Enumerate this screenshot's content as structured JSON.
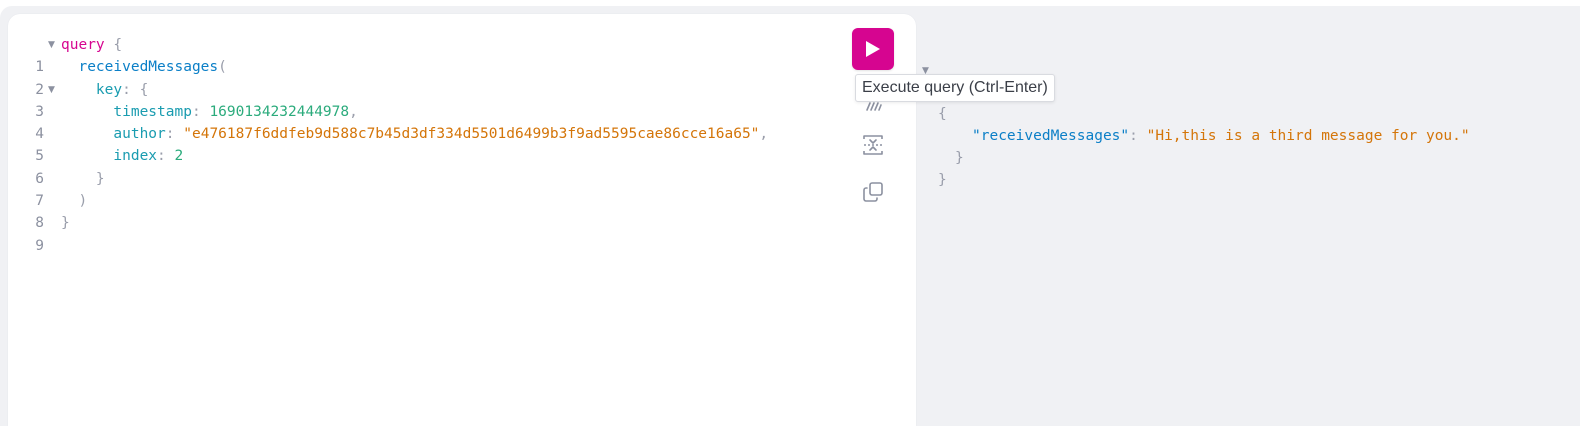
{
  "toolbar": {
    "run_tooltip": "Execute query (Ctrl-Enter)",
    "run_icon": "play-icon",
    "prettify_icon": "prettify-icon",
    "merge_icon": "merge-fragments-icon",
    "copy_icon": "copy-icon"
  },
  "editor": {
    "line_numbers": [
      "1",
      "2",
      "3",
      "4",
      "5",
      "6",
      "7",
      "8",
      "9"
    ],
    "query_keyword": "query",
    "open_brace": "{",
    "field_name": "receivedMessages",
    "open_paren": "(",
    "arg_key": "key",
    "arg_key_colon": ":",
    "arg_key_brace": "{",
    "timestamp_label": "timestamp",
    "timestamp_value": "1690134232444978",
    "author_label": "author",
    "author_value": "\"e476187f6ddfeb9d588c7b45d3df334d5501d6499b3f9ad5595cae86cce16a65\"",
    "index_label": "index",
    "index_value": "2",
    "colon": ":",
    "comma": ",",
    "close_inner_brace": "}",
    "close_paren": ")",
    "close_brace": "}"
  },
  "result": {
    "open_brace": "{",
    "key": "\"receivedMessages\"",
    "colon": ":",
    "value": "\"Hi,this is a third message for you.\"",
    "close_inner": "}",
    "close_outer": "}"
  },
  "colors": {
    "accent": "#d60590",
    "keyword": "#d60590",
    "field": "#0b7fc7",
    "argument": "#1a9cb0",
    "number": "#2bab7c",
    "string": "#d47509",
    "punctuation": "#9a9eab",
    "background": "#f0f1f4"
  }
}
